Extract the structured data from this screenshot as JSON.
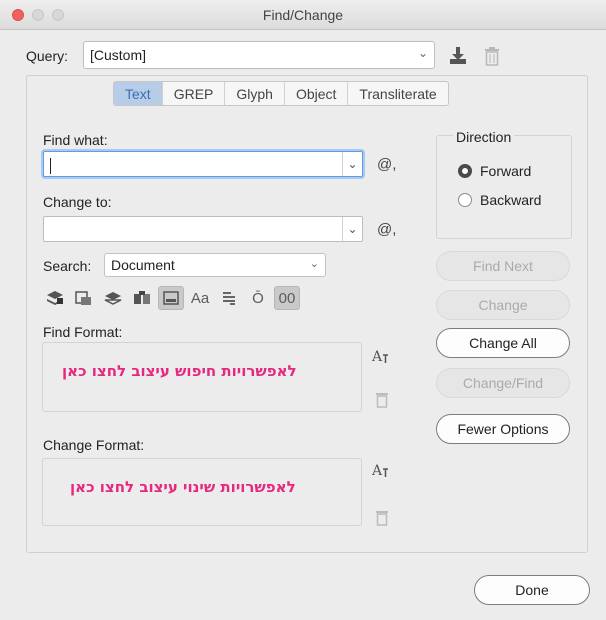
{
  "window": {
    "title": "Find/Change"
  },
  "query": {
    "label": "Query:",
    "value": "[Custom]"
  },
  "tabs": [
    {
      "label": "Text",
      "active": true
    },
    {
      "label": "GREP"
    },
    {
      "label": "Glyph"
    },
    {
      "label": "Object"
    },
    {
      "label": "Transliterate"
    }
  ],
  "find": {
    "label": "Find what:",
    "value": "",
    "special_chars_icon": "@,"
  },
  "change": {
    "label": "Change to:",
    "value": "",
    "special_chars_icon": "@,"
  },
  "search": {
    "label": "Search:",
    "value": "Document"
  },
  "options": {
    "icons": [
      "lock-layers-icon",
      "hidden-layers-icon",
      "master-pages-icon",
      "footnotes-icon",
      "hidden-objects-icon",
      "case-sensitive-icon",
      "whole-word-icon",
      "kana-icon",
      "width-icon"
    ],
    "case_label": "Aa",
    "kana_label": "Ō",
    "width_label": "00"
  },
  "find_format": {
    "label": "Find Format:",
    "annotation": "לאפשרויות חיפוש עיצוב לחצו כאן"
  },
  "change_format": {
    "label": "Change Format:",
    "annotation": "לאפשרויות שינוי עיצוב לחצו כאן"
  },
  "direction": {
    "title": "Direction",
    "forward": "Forward",
    "backward": "Backward",
    "selected": "Forward"
  },
  "buttons": {
    "find_next": "Find Next",
    "change": "Change",
    "change_all": "Change All",
    "change_find": "Change/Find",
    "fewer_options": "Fewer Options",
    "done": "Done"
  },
  "colors": {
    "annotation": "#e6287f",
    "tab_active": "#b7cce6",
    "focus": "#5f9de5"
  }
}
